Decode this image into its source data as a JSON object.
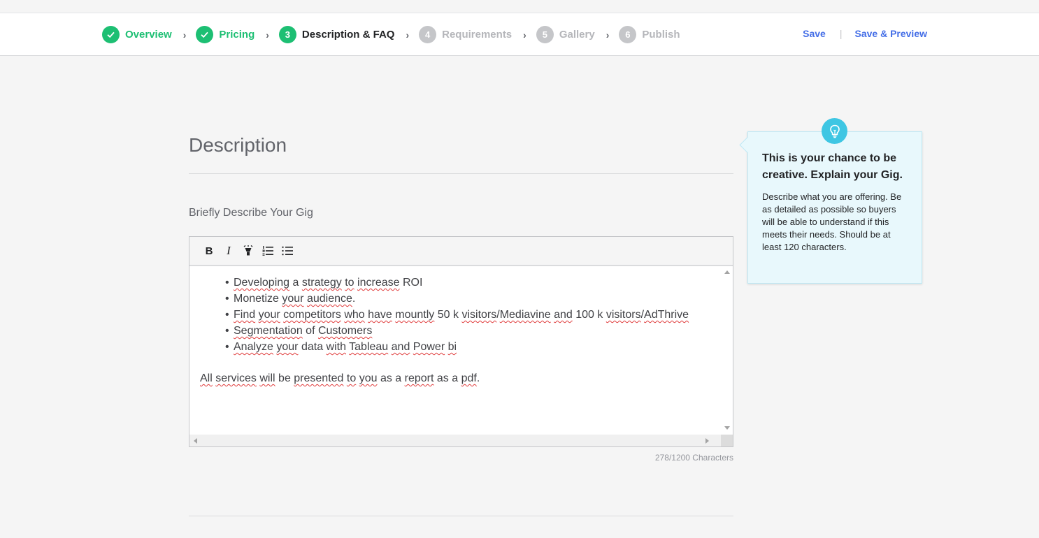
{
  "steps": [
    {
      "num": "1",
      "label": "Overview",
      "state": "done"
    },
    {
      "num": "2",
      "label": "Pricing",
      "state": "done"
    },
    {
      "num": "3",
      "label": "Description & FAQ",
      "state": "active"
    },
    {
      "num": "4",
      "label": "Requirements",
      "state": "pending"
    },
    {
      "num": "5",
      "label": "Gallery",
      "state": "pending"
    },
    {
      "num": "6",
      "label": "Publish",
      "state": "pending"
    }
  ],
  "actions": {
    "save": "Save",
    "save_preview": "Save & Preview",
    "separator": "|"
  },
  "section": {
    "title": "Description"
  },
  "field": {
    "label": "Briefly Describe Your Gig",
    "counter": "278/1200 Characters",
    "toolbar": {
      "bold": "B",
      "italic": "I"
    }
  },
  "tip": {
    "title": "This is your chance to be creative. Explain your Gig.",
    "body": "Describe what you are offering. Be as detailed as possible so buyers will be able to understand if this meets their needs. Should be at least 120 characters."
  },
  "colors": {
    "green": "#1dbf73",
    "link": "#446ee7",
    "tip_accent": "#3ec6e3"
  }
}
